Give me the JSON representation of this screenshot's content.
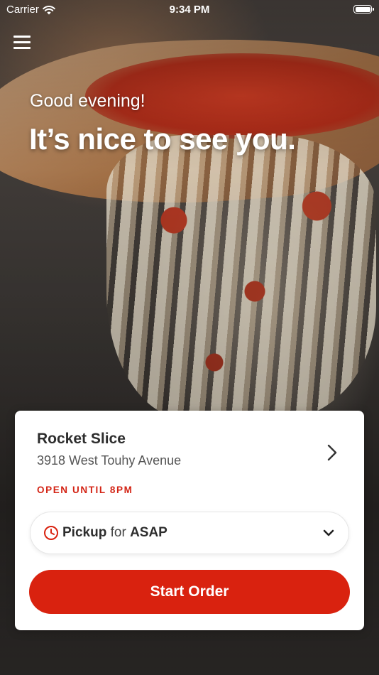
{
  "status_bar": {
    "carrier": "Carrier",
    "time": "9:34 PM"
  },
  "hero": {
    "greeting": "Good evening!",
    "headline": "It’s nice to see you."
  },
  "store": {
    "name": "Rocket Slice",
    "address": "3918 West Touhy Avenue",
    "open_status": "OPEN UNTIL 8PM"
  },
  "order_type": {
    "method": "Pickup",
    "connector": "for",
    "time": "ASAP"
  },
  "actions": {
    "start_order_label": "Start Order"
  },
  "colors": {
    "accent": "#d9220f",
    "status_text": "#d32314"
  },
  "icons": {
    "menu": "hamburger-menu-icon",
    "store_chevron": "chevron-right-icon",
    "clock": "clock-icon",
    "dropdown": "chevron-down-icon",
    "wifi": "wifi-icon",
    "battery": "battery-icon"
  }
}
